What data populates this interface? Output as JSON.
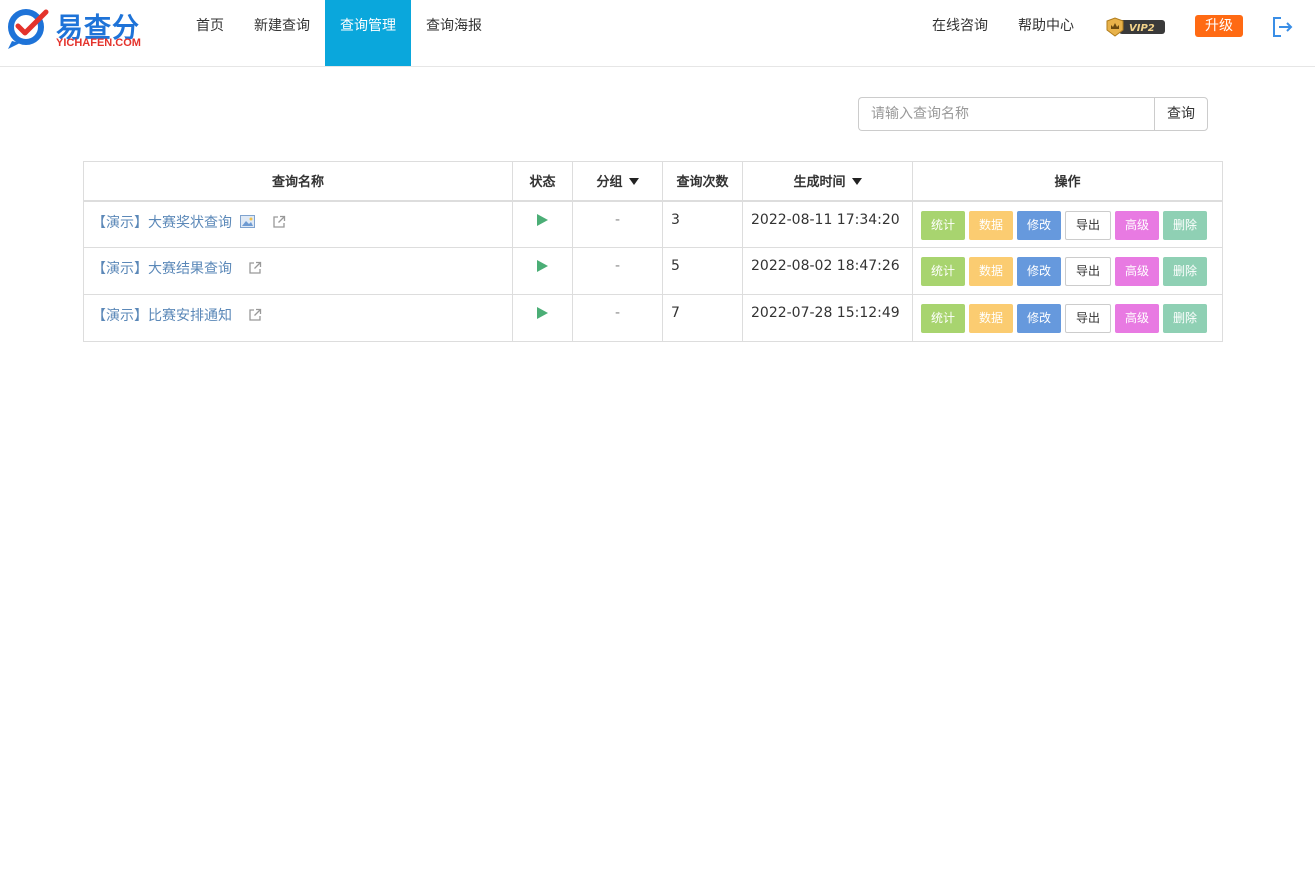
{
  "header": {
    "logo_cn": "易查分",
    "logo_en": "YICHAFEN.COM",
    "nav": [
      {
        "label": "首页"
      },
      {
        "label": "新建查询"
      },
      {
        "label": "查询管理"
      },
      {
        "label": "查询海报"
      }
    ],
    "consult": "在线咨询",
    "help": "帮助中心",
    "vip_badge": "VIP2",
    "upgrade": "升级"
  },
  "search": {
    "placeholder": "请输入查询名称",
    "button": "查询"
  },
  "table": {
    "columns": [
      "查询名称",
      "状态",
      "分组",
      "查询次数",
      "生成时间",
      "操作"
    ],
    "rows": [
      {
        "name": "【演示】大赛奖状查询",
        "group": "-",
        "count": "3",
        "time": "2022-08-11 17:34:20"
      },
      {
        "name": "【演示】大赛结果查询",
        "group": "-",
        "count": "5",
        "time": "2022-08-02 18:47:26"
      },
      {
        "name": "【演示】比赛安排通知",
        "group": "-",
        "count": "7",
        "time": "2022-07-28 15:12:49"
      }
    ],
    "actions": {
      "stat": "统计",
      "data": "数据",
      "edit": "修改",
      "export": "导出",
      "advanced": "高级",
      "delete": "删除"
    }
  },
  "colors": {
    "nav_active": "#0aa7dc",
    "upgrade": "#ff6a13",
    "link": "#5b88b8"
  }
}
